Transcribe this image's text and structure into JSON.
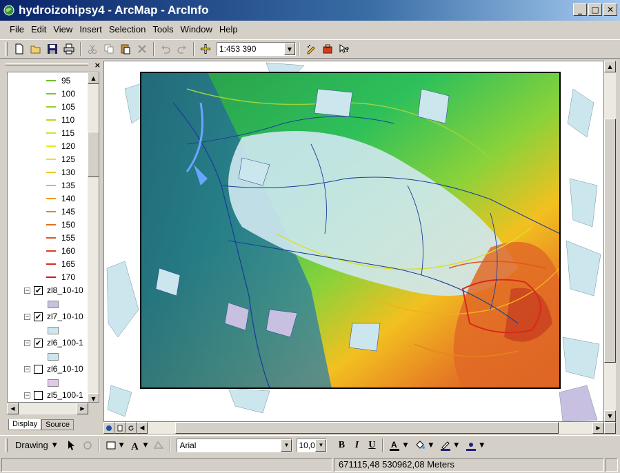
{
  "window": {
    "title": "hydroizohipsy4 - ArcMap - ArcInfo",
    "minimize": "_",
    "maximize": "□",
    "close": "✕"
  },
  "menu": {
    "items": [
      "File",
      "Edit",
      "View",
      "Insert",
      "Selection",
      "Tools",
      "Window",
      "Help"
    ]
  },
  "toolbar": {
    "scale": "1:453 390",
    "icons": [
      "new-icon",
      "open-icon",
      "save-icon",
      "print-icon",
      "cut-icon",
      "copy-icon",
      "paste-icon",
      "delete-icon",
      "undo-icon",
      "redo-icon",
      "add-data-icon",
      "editor-icon",
      "arctoolbox-icon",
      "whats-this-icon"
    ]
  },
  "toc": {
    "close": "×",
    "legend": [
      {
        "label": "95",
        "color": "#6abf2c"
      },
      {
        "label": "100",
        "color": "#7cc52a"
      },
      {
        "label": "105",
        "color": "#98cf28"
      },
      {
        "label": "110",
        "color": "#b4d925"
      },
      {
        "label": "115",
        "color": "#d2e322"
      },
      {
        "label": "120",
        "color": "#e8e81f"
      },
      {
        "label": "125",
        "color": "#f0df1c"
      },
      {
        "label": "130",
        "color": "#f1cc1c"
      },
      {
        "label": "135",
        "color": "#efb51c"
      },
      {
        "label": "140",
        "color": "#ec9c1c"
      },
      {
        "label": "145",
        "color": "#e8841c"
      },
      {
        "label": "150",
        "color": "#e46c1c"
      },
      {
        "label": "155",
        "color": "#e0551c"
      },
      {
        "label": "160",
        "color": "#dc3d1c"
      },
      {
        "label": "165",
        "color": "#d8281c"
      },
      {
        "label": "170",
        "color": "#d0141c"
      }
    ],
    "layers": [
      {
        "name": "zl8_10-10",
        "checked": true,
        "fill": "#c8c0e0",
        "check_mark": "✔"
      },
      {
        "name": "zl7_10-10",
        "checked": true,
        "fill": "#cce6ee",
        "check_mark": "✔"
      },
      {
        "name": "zl6_100-1",
        "checked": true,
        "fill": "#cce6ee",
        "check_mark": "✔"
      },
      {
        "name": "zl6_10-10",
        "checked": false,
        "fill": "#e0c8e8",
        "check_mark": ""
      },
      {
        "name": "zl5_100-1",
        "checked": false,
        "fill": "",
        "check_mark": ""
      }
    ],
    "tabs": [
      "Display",
      "Source"
    ]
  },
  "drawing": {
    "label": "Drawing",
    "font": "Arial",
    "size": "10,0",
    "bold": "B",
    "italic": "I",
    "underline": "U"
  },
  "status": {
    "coordinates": "671115,48  530962,08 Meters"
  }
}
